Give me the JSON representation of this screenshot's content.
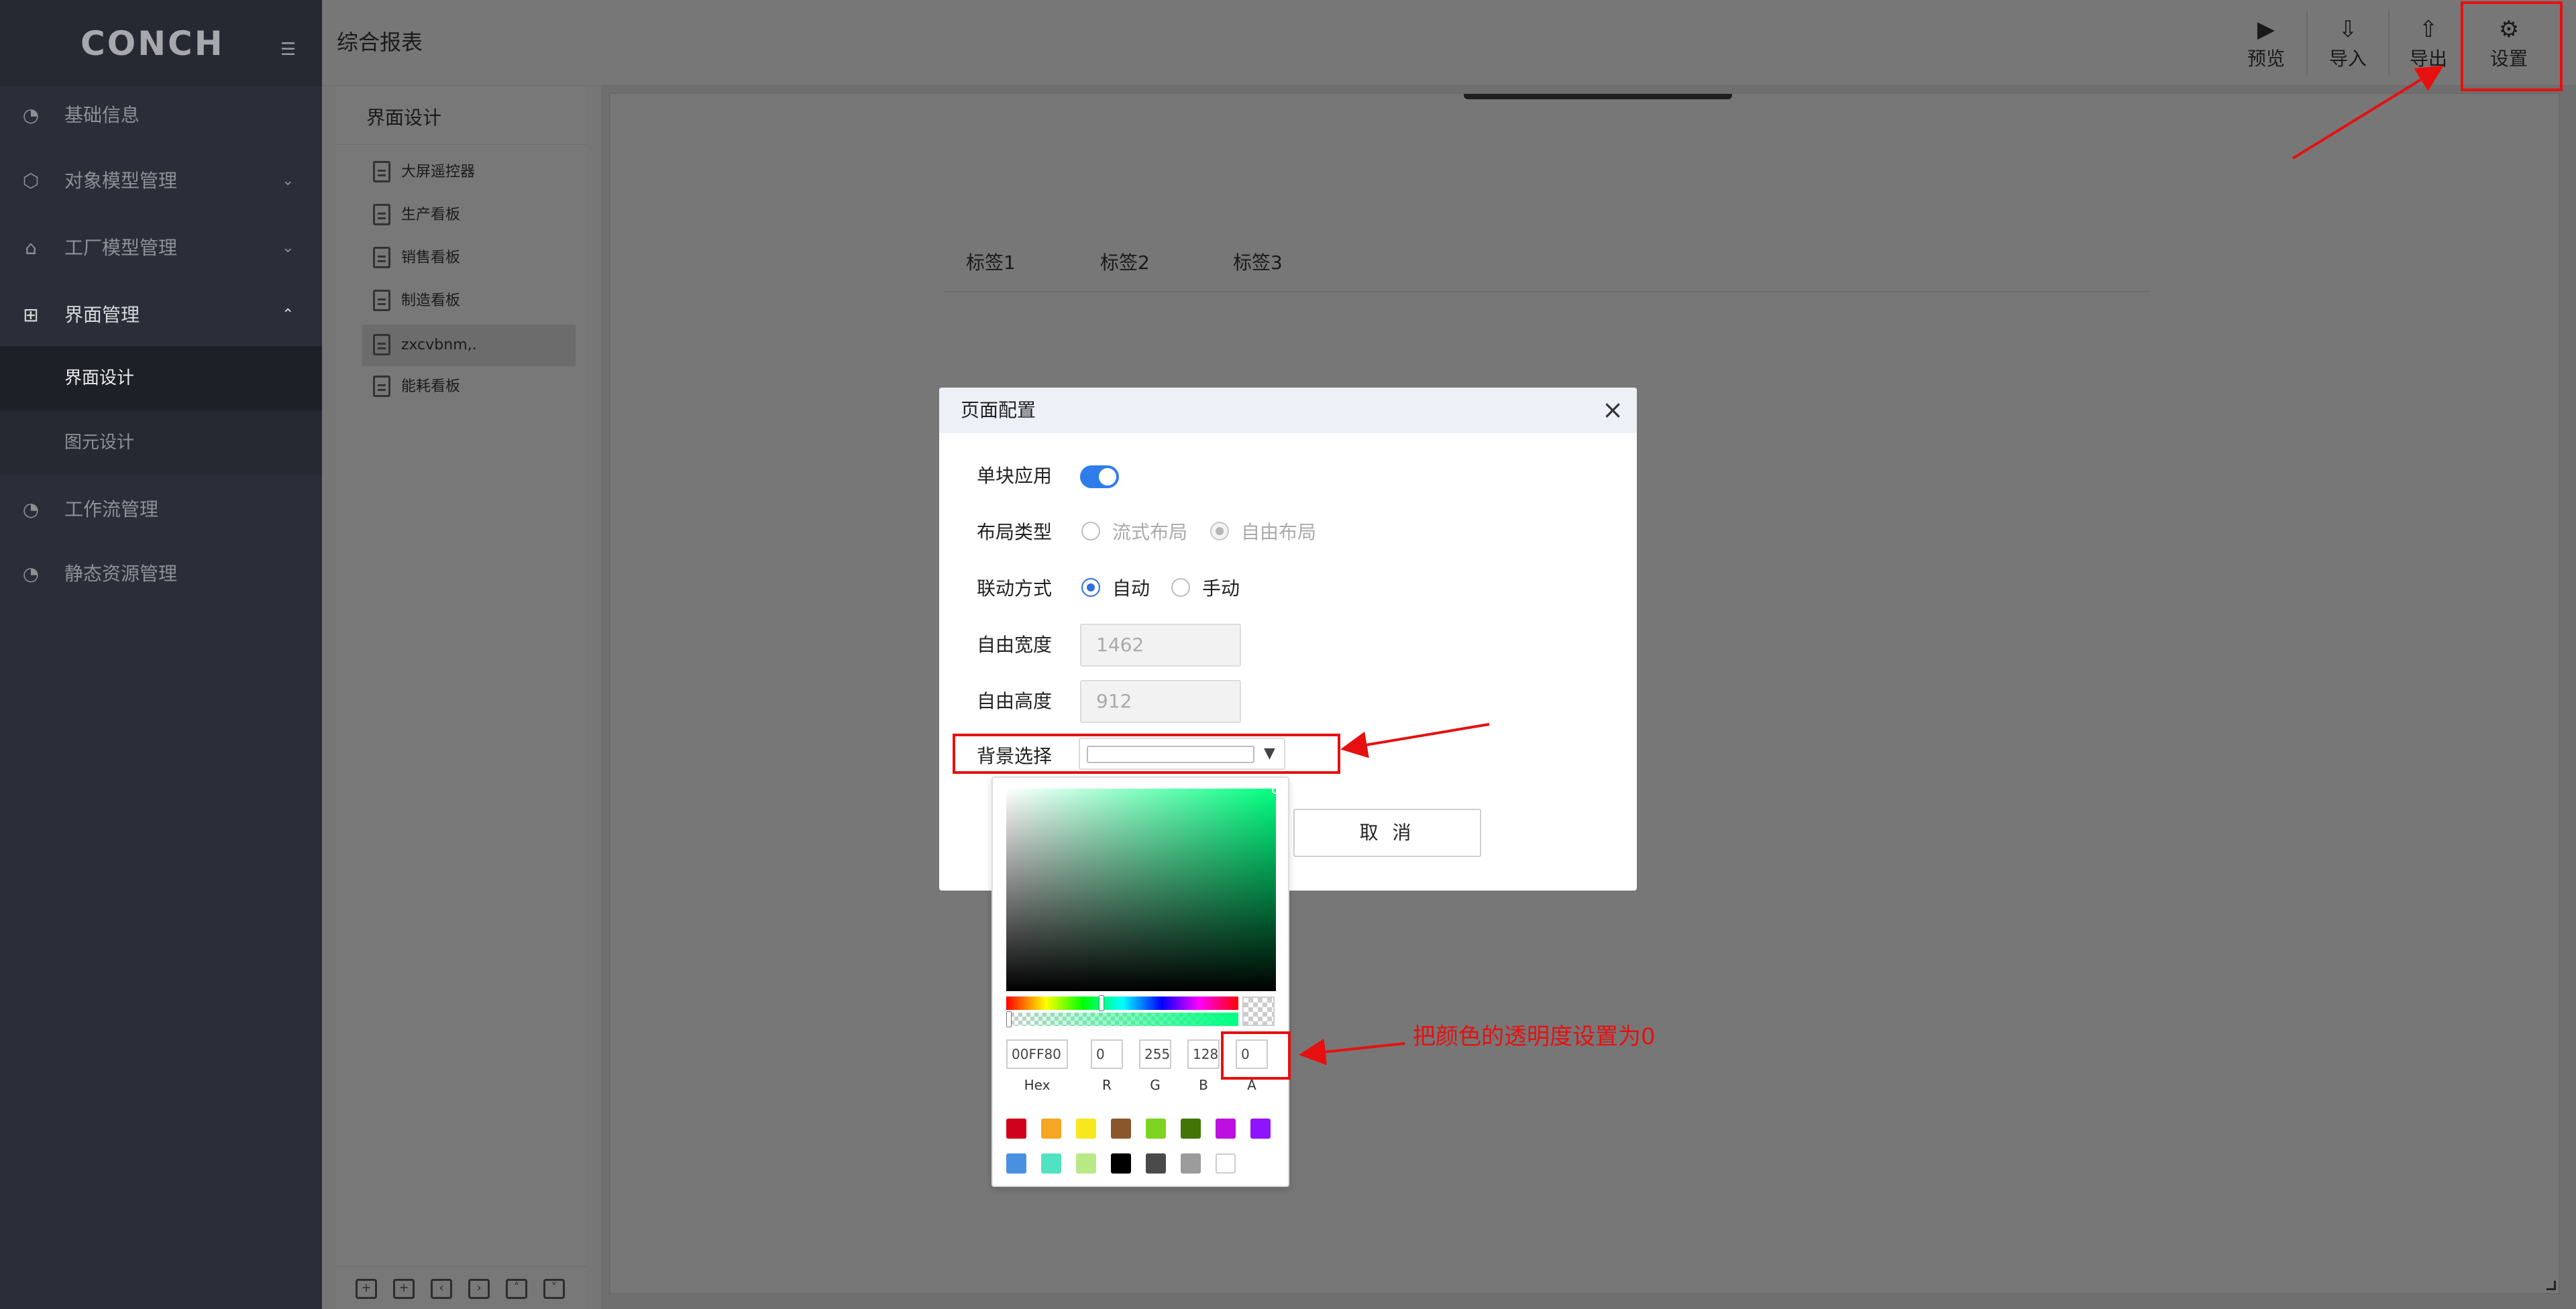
{
  "sidebar": {
    "logo": "CONCH",
    "items": [
      {
        "label": "基础信息",
        "icon": "pie-chart-icon"
      },
      {
        "label": "对象模型管理",
        "icon": "cube-icon"
      },
      {
        "label": "工厂模型管理",
        "icon": "factory-icon"
      },
      {
        "label": "界面管理",
        "icon": "layout-icon"
      },
      {
        "label": "工作流管理",
        "icon": "pie-chart-icon"
      },
      {
        "label": "静态资源管理",
        "icon": "pie-chart-icon"
      }
    ],
    "submenu": [
      {
        "label": "界面设计"
      },
      {
        "label": "图元设计"
      }
    ]
  },
  "header": {
    "title": "综合报表",
    "tools": [
      {
        "label": "预览",
        "icon": "play-icon"
      },
      {
        "label": "导入",
        "icon": "import-icon"
      },
      {
        "label": "导出",
        "icon": "export-icon"
      },
      {
        "label": "设置",
        "icon": "gear-icon"
      }
    ]
  },
  "tree": {
    "title": "界面设计",
    "files": [
      {
        "label": "大屏遥控器"
      },
      {
        "label": "生产看板"
      },
      {
        "label": "销售看板"
      },
      {
        "label": "制造看板"
      },
      {
        "label": "zxcvbnm,."
      },
      {
        "label": "能耗看板"
      }
    ]
  },
  "canvas": {
    "tabs": [
      {
        "label": "标签1"
      },
      {
        "label": "标签2"
      },
      {
        "label": "标签3"
      }
    ]
  },
  "modal": {
    "title": "页面配置",
    "single_app_label": "单块应用",
    "single_app_on": true,
    "layout_label": "布局类型",
    "layout_options": [
      {
        "label": "流式布局",
        "checked": false,
        "disabled": true
      },
      {
        "label": "自由布局",
        "checked": true,
        "disabled": true
      }
    ],
    "link_label": "联动方式",
    "link_options": [
      {
        "label": "自动",
        "checked": true
      },
      {
        "label": "手动",
        "checked": false
      }
    ],
    "width_label": "自由宽度",
    "width_value": "1462",
    "height_label": "自由高度",
    "height_value": "912",
    "bg_label": "背景选择",
    "cancel_label": "取 消"
  },
  "color_picker": {
    "color": "#00FF80",
    "hex_value": "00FF80",
    "r_value": "0",
    "g_value": "255",
    "b_value": "128",
    "a_value": "0",
    "labels": [
      "Hex",
      "R",
      "G",
      "B",
      "A"
    ],
    "swatches_row1": [
      "#D0021B",
      "#F5A623",
      "#F8E71C",
      "#8B572A",
      "#7ED321",
      "#417505",
      "#BD10E0",
      "#9013FE"
    ],
    "swatches_row2": [
      "#4A90E2",
      "#50E3C2",
      "#B8E986",
      "#000000",
      "#4A4A4A",
      "#9B9B9B",
      "#FFFFFF"
    ]
  },
  "annotation": {
    "note": "把颜色的透明度设置为0",
    "color": "#E61010"
  }
}
